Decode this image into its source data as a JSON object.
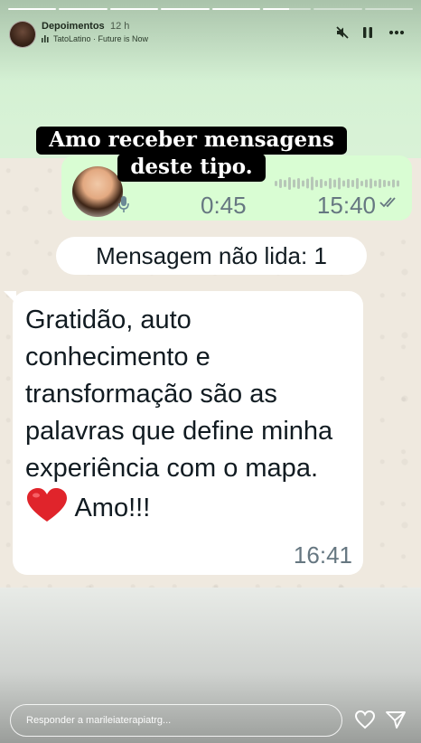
{
  "story": {
    "progress": [
      1,
      1,
      1,
      1,
      1,
      0.55,
      0,
      0
    ],
    "username": "Depoimentos",
    "time_ago": "12 h",
    "music": "TatoLatino · Future is Now",
    "caption_line1": "Amo receber mensagens",
    "caption_line2": "deste tipo."
  },
  "voice_message": {
    "duration": "0:45",
    "time": "15:40"
  },
  "unread_label": "Mensagem não lida: 1",
  "message": {
    "text": "Gratidão, auto conhecimento e transformação são as palavras que define minha experiência com o mapa.",
    "emoji": "heart",
    "text_after": "Amo!!!",
    "time": "16:41"
  },
  "reply": {
    "placeholder": "Responder a marileiaterapiatrg..."
  },
  "colors": {
    "bubble_green": "#d9fdd3",
    "bubble_white": "#ffffff",
    "heart_red": "#e0242b"
  }
}
